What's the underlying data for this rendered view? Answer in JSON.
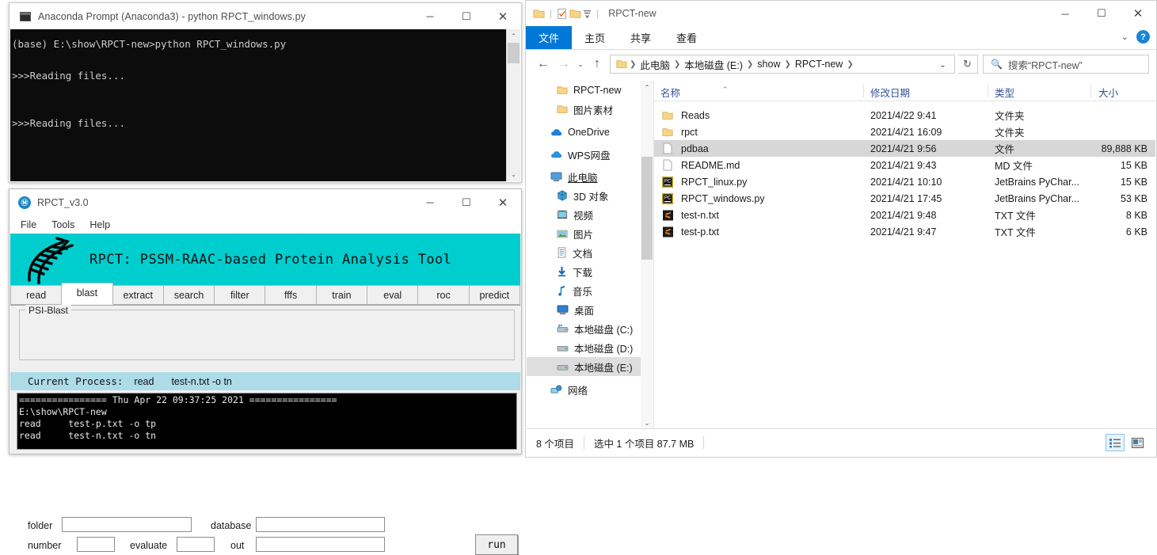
{
  "anaconda": {
    "title": "Anaconda Prompt (Anaconda3) - python  RPCT_windows.py",
    "icon": "console-icon",
    "console_text": "(base) E:\\show\\RPCT-new>python RPCT_windows.py\n\n>>>Reading files...\n\n\n>>>Reading files...",
    "controls": {
      "minimize": "─",
      "maximize": "☐",
      "close": "✕"
    },
    "scroll": {
      "up": "⌃",
      "down": "⌄"
    }
  },
  "rpct": {
    "title": "RPCT_v3.0",
    "icon_letter": "Ⓜ",
    "controls": {
      "minimize": "─",
      "maximize": "☐",
      "close": "✕"
    },
    "menu": [
      "File",
      "Tools",
      "Help"
    ],
    "banner_title": "RPCT: PSSM-RAAC-based Protein Analysis Tool",
    "banner_color": "#00cdcd",
    "tabs": [
      {
        "label": "read",
        "active": false
      },
      {
        "label": "blast",
        "active": true
      },
      {
        "label": "extract",
        "active": false
      },
      {
        "label": "search",
        "active": false
      },
      {
        "label": "filter",
        "active": false
      },
      {
        "label": "fffs",
        "active": false
      },
      {
        "label": "train",
        "active": false
      },
      {
        "label": "eval",
        "active": false
      },
      {
        "label": "roc",
        "active": false
      },
      {
        "label": "predict",
        "active": false
      }
    ],
    "group_label": "PSI-Blast",
    "fields": [
      {
        "label": "folder",
        "value": ""
      },
      {
        "label": "database",
        "value": ""
      },
      {
        "label": "number",
        "value": ""
      },
      {
        "label": "evaluate",
        "value": ""
      },
      {
        "label": "out",
        "value": ""
      }
    ],
    "run_label": "run",
    "process": {
      "prefix": "Current Process:",
      "command": "read",
      "args": "test-n.txt -o tn",
      "bar_color": "#addbe8"
    },
    "terminal_text": "================ Thu Apr 22 09:37:25 2021 ================\nE:\\show\\RPCT-new\nread     test-p.txt -o tp\nread     test-n.txt -o tn"
  },
  "explorer": {
    "title": "RPCT-new",
    "controls": {
      "minimize": "─",
      "maximize": "☐",
      "close": "✕"
    },
    "quick_access": [
      "folder-icon",
      "properties-icon",
      "new-folder-icon",
      "customize-dropdown-icon"
    ],
    "ribbon_tabs": [
      {
        "label": "文件",
        "active": true
      },
      {
        "label": "主页",
        "active": false
      },
      {
        "label": "共享",
        "active": false
      },
      {
        "label": "查看",
        "active": false
      }
    ],
    "ribbon_help": "?",
    "ribbon_collapse": "⌄",
    "nav": {
      "back": "←",
      "forward": "→",
      "recent": "⌄",
      "up": "↑",
      "refresh": "↻",
      "dropdown": "⌄"
    },
    "breadcrumb": [
      "此电脑",
      "本地磁盘 (E:)",
      "show",
      "RPCT-new"
    ],
    "search_placeholder": "搜索“RPCT-new”",
    "search_icon": "search-icon",
    "nav_items": [
      {
        "label": "RPCT-new",
        "icon": "folder-icon",
        "indent": 1,
        "selected": false
      },
      {
        "label": "图片素材",
        "icon": "folder-icon",
        "indent": 1,
        "selected": false
      },
      {
        "label": "OneDrive",
        "icon": "cloud-icon",
        "indent": 0,
        "selected": false
      },
      {
        "label": "WPS网盘",
        "icon": "cloud-icon",
        "indent": 0,
        "selected": false
      },
      {
        "label": "此电脑",
        "icon": "computer-icon",
        "indent": 0,
        "selected": false
      },
      {
        "label": "3D 对象",
        "icon": "3d-objects-icon",
        "indent": 2,
        "selected": false
      },
      {
        "label": "视频",
        "icon": "video-icon",
        "indent": 2,
        "selected": false
      },
      {
        "label": "图片",
        "icon": "pictures-icon",
        "indent": 2,
        "selected": false
      },
      {
        "label": "文档",
        "icon": "documents-icon",
        "indent": 2,
        "selected": false
      },
      {
        "label": "下载",
        "icon": "downloads-icon",
        "indent": 2,
        "selected": false
      },
      {
        "label": "音乐",
        "icon": "music-icon",
        "indent": 2,
        "selected": false
      },
      {
        "label": "桌面",
        "icon": "desktop-icon",
        "indent": 2,
        "selected": false
      },
      {
        "label": "本地磁盘 (C:)",
        "icon": "drive-system-icon",
        "indent": 2,
        "selected": false
      },
      {
        "label": "本地磁盘 (D:)",
        "icon": "drive-icon",
        "indent": 2,
        "selected": false
      },
      {
        "label": "本地磁盘 (E:)",
        "icon": "drive-icon",
        "indent": 2,
        "selected": true
      },
      {
        "label": "网络",
        "icon": "network-icon",
        "indent": 0,
        "selected": false
      }
    ],
    "nav_scroll": {
      "up": "⌃",
      "down": "⌄"
    },
    "columns": [
      {
        "label": "名称",
        "key": "name"
      },
      {
        "label": "修改日期",
        "key": "date"
      },
      {
        "label": "类型",
        "key": "type"
      },
      {
        "label": "大小",
        "key": "size"
      }
    ],
    "sort_indicator": "⌃",
    "files": [
      {
        "name": "Reads",
        "date": "2021/4/22 9:41",
        "type": "文件夹",
        "size": "",
        "icon": "folder-icon",
        "selected": false
      },
      {
        "name": "rpct",
        "date": "2021/4/21 16:09",
        "type": "文件夹",
        "size": "",
        "icon": "folder-icon",
        "selected": false
      },
      {
        "name": "pdbaa",
        "date": "2021/4/21 9:56",
        "type": "文件",
        "size": "89,888 KB",
        "icon": "blank-file-icon",
        "selected": true
      },
      {
        "name": "README.md",
        "date": "2021/4/21 9:43",
        "type": "MD 文件",
        "size": "15 KB",
        "icon": "blank-file-icon",
        "selected": false
      },
      {
        "name": "RPCT_linux.py",
        "date": "2021/4/21 10:10",
        "type": "JetBrains PyChar...",
        "size": "15 KB",
        "icon": "pycharm-icon",
        "selected": false
      },
      {
        "name": "RPCT_windows.py",
        "date": "2021/4/21 17:45",
        "type": "JetBrains PyChar...",
        "size": "53 KB",
        "icon": "pycharm-icon",
        "selected": false
      },
      {
        "name": "test-n.txt",
        "date": "2021/4/21 9:48",
        "type": "TXT 文件",
        "size": "8 KB",
        "icon": "sublime-icon",
        "selected": false
      },
      {
        "name": "test-p.txt",
        "date": "2021/4/21 9:47",
        "type": "TXT 文件",
        "size": "6 KB",
        "icon": "sublime-icon",
        "selected": false
      }
    ],
    "status": {
      "count": "8 个项目",
      "selection": "选中 1 个项目  87.7 MB"
    },
    "view_buttons": [
      {
        "name": "details-view-icon",
        "active": true
      },
      {
        "name": "large-icons-view-icon",
        "active": false
      }
    ]
  }
}
